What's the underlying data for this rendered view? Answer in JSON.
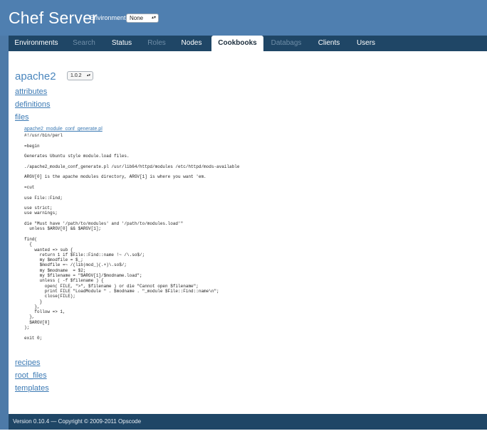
{
  "header": {
    "title": "Chef Server",
    "environment_label": "Environment:",
    "environment_value": "None"
  },
  "nav": {
    "tabs": [
      {
        "label": "Environments",
        "state": "enabled"
      },
      {
        "label": "Search",
        "state": "disabled"
      },
      {
        "label": "Status",
        "state": "enabled"
      },
      {
        "label": "Roles",
        "state": "disabled"
      },
      {
        "label": "Nodes",
        "state": "enabled"
      },
      {
        "label": "Cookbooks",
        "state": "active"
      },
      {
        "label": "Databags",
        "state": "disabled"
      },
      {
        "label": "Clients",
        "state": "enabled"
      },
      {
        "label": "Users",
        "state": "enabled"
      }
    ]
  },
  "cookbook": {
    "name": "apache2",
    "version": "1.0.2",
    "sections": {
      "attributes": "attributes",
      "definitions": "definitions",
      "files": "files",
      "recipes": "recipes",
      "root_files": "root_files",
      "templates": "templates"
    },
    "file": {
      "name": "apache2_module_conf_generate.pl",
      "content": "#!/usr/bin/perl\n\n=begin\n\nGenerates Ubuntu style module.load files.\n\n./apache2_module_conf_generate.pl /usr/lib64/httpd/modules /etc/httpd/mods-available\n\nARGV[0] is the apache modules directory, ARGV[1] is where you want 'em.\n\n=cut\n\nuse File::Find;\n\nuse strict;\nuse warnings;\n\ndie \"Must have '/path/to/modules' and '/path/to/modules.load'\"\n  unless $ARGV[0] && $ARGV[1];\n\nfind(\n  {\n    wanted => sub {\n      return 1 if $File::Find::name !~ /\\.so$/;\n      my $modfile = $_;\n      $modfile =~ /(lib|mod_)(.+)\\.so$/;\n      my $modname  = $2;\n      my $filename = \"$ARGV[1]/$modname.load\";\n      unless ( -f $filename ) {\n        open( FILE, \">\", $filename ) or die \"Cannot open $filename\";\n        print FILE \"LoadModule \" . $modname . \"_module $File::Find::name\\n\";\n        close(FILE);\n      }\n    },\n    follow => 1,\n  },\n  $ARGV[0]\n);\n\nexit 0;"
    }
  },
  "footer": {
    "text": "Version 0.10.4 — Copyright © 2009-2011 Opscode"
  },
  "colors": {
    "header_bg": "#4f7fb0",
    "nav_bg": "#1f4666",
    "link": "#3c7ab4",
    "disabled_tab": "#6f8ea8"
  }
}
